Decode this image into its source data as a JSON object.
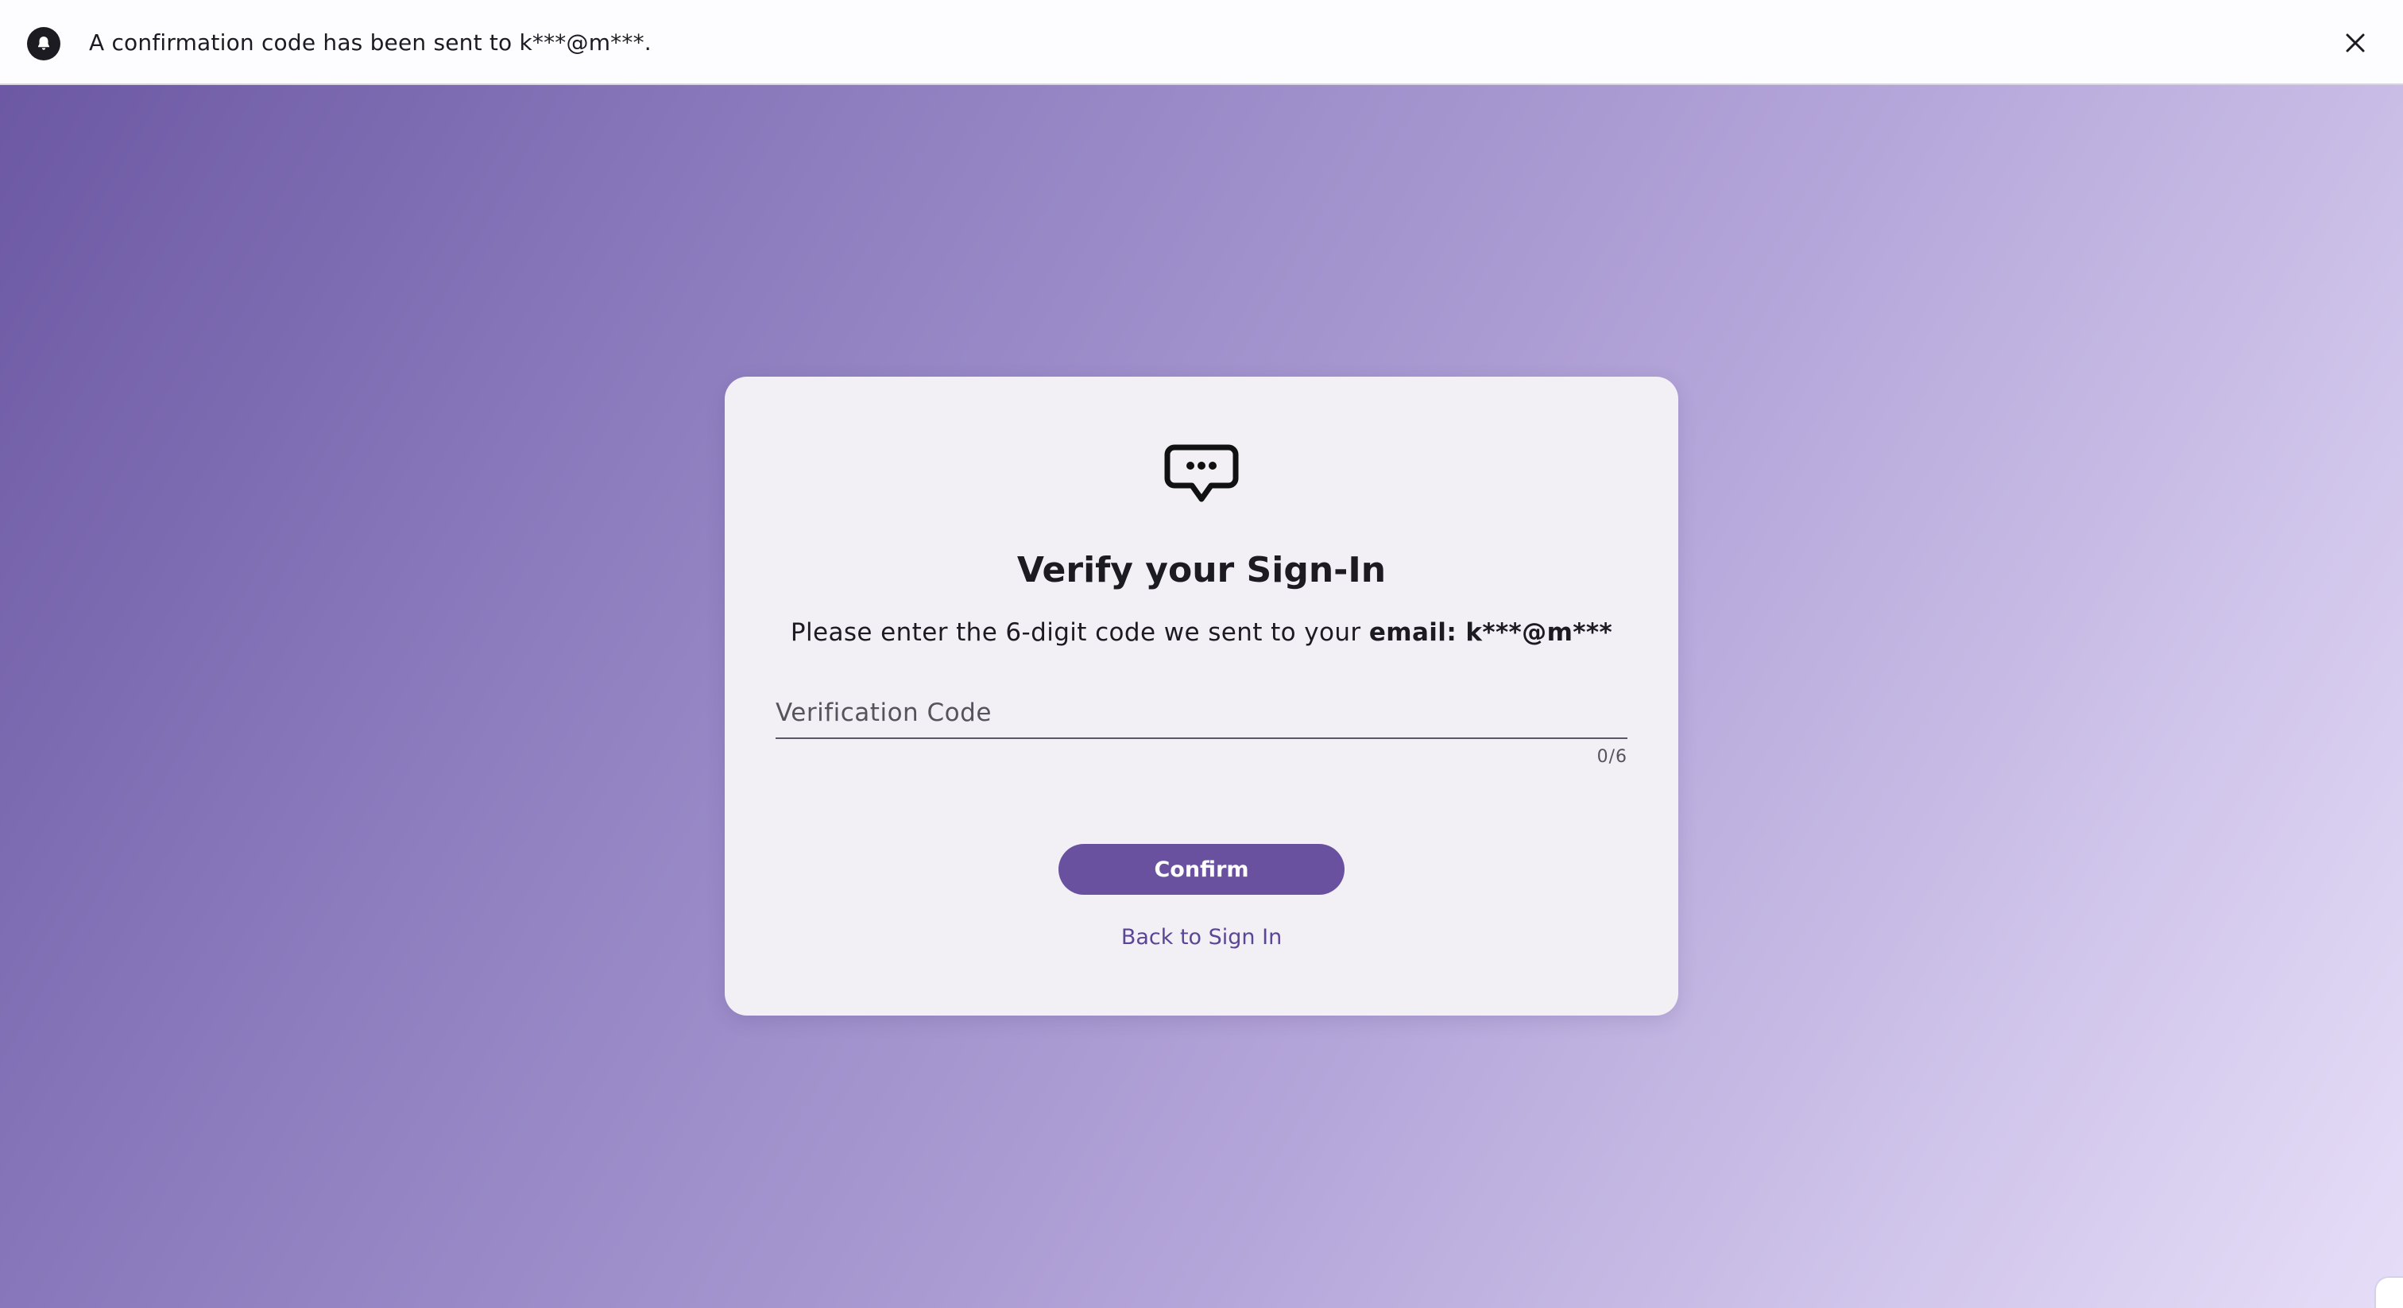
{
  "banner": {
    "icon": "bell-icon",
    "message": "A confirmation code has been sent to k***@m***.",
    "close_icon": "close-icon"
  },
  "card": {
    "icon": "chat-bubble-ellipsis-icon",
    "title": "Verify your Sign-In",
    "subtitle_prefix": "Please enter the 6-digit code we sent to your ",
    "subtitle_emphasis": "email: k***@m***",
    "code_field": {
      "placeholder": "Verification Code",
      "value": "",
      "counter": "0/6"
    },
    "confirm_label": "Confirm",
    "back_label": "Back to Sign In"
  },
  "colors": {
    "accent": "#6951a0",
    "link": "#5b4597",
    "card_bg": "#f2f0f5",
    "banner_bg": "#fdfcff",
    "gradient_start": "#6a56a2",
    "gradient_end": "#e6def8"
  }
}
